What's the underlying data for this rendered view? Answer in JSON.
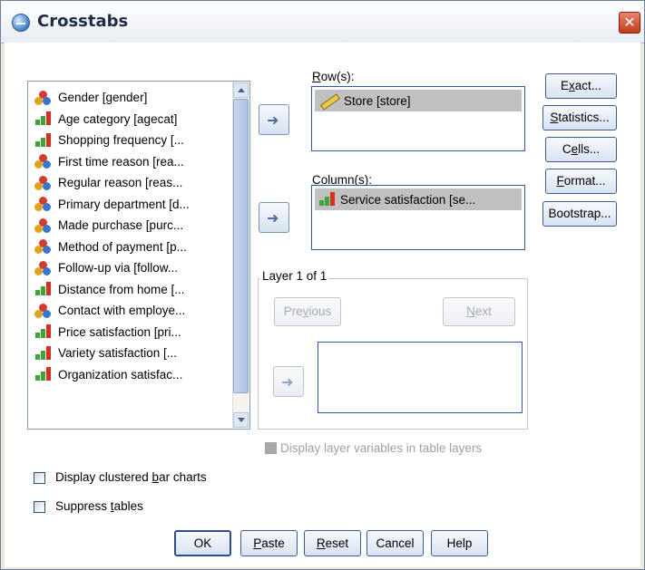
{
  "window": {
    "title": "Crosstabs",
    "close_glyph": "✕",
    "icon": "crosstabs-app-icon"
  },
  "variables": [
    {
      "label": "Gender [gender]",
      "measure": "nominal"
    },
    {
      "label": "Age category [agecat]",
      "measure": "ordinal"
    },
    {
      "label": "Shopping frequency [...",
      "measure": "ordinal"
    },
    {
      "label": "First time reason [rea...",
      "measure": "nominal"
    },
    {
      "label": "Regular reason [reas...",
      "measure": "nominal"
    },
    {
      "label": "Primary department [d...",
      "measure": "nominal"
    },
    {
      "label": "Made purchase [purc...",
      "measure": "nominal"
    },
    {
      "label": "Method of payment [p...",
      "measure": "nominal"
    },
    {
      "label": "Follow-up via [follow...",
      "measure": "nominal"
    },
    {
      "label": "Distance from home [...",
      "measure": "ordinal"
    },
    {
      "label": "Contact with employe...",
      "measure": "nominal"
    },
    {
      "label": "Price satisfaction [pri...",
      "measure": "ordinal"
    },
    {
      "label": "Variety satisfaction [...",
      "measure": "ordinal"
    },
    {
      "label": "Organization satisfac...",
      "measure": "ordinal"
    }
  ],
  "rows": {
    "label_prefix": "",
    "label_hot": "R",
    "label_rest": "ow(s):",
    "items": [
      {
        "label": "Store [store]",
        "measure": "scale"
      }
    ]
  },
  "columns": {
    "label_hot": "C",
    "label_rest": "olumn(s):",
    "items": [
      {
        "label": "Service satisfaction [se...",
        "measure": "ordinal"
      }
    ]
  },
  "layer": {
    "title": "Layer 1 of 1",
    "previous_pre": "Pre",
    "previous_hot": "v",
    "previous_post": "ious",
    "next_hot": "N",
    "next_post": "ext"
  },
  "side_buttons": {
    "exact_pre": "E",
    "exact_hot": "x",
    "exact_post": "act...",
    "statistics_hot": "S",
    "statistics_post": "tatistics...",
    "cells_pre": "C",
    "cells_hot": "e",
    "cells_post": "lls...",
    "format_hot": "F",
    "format_post": "ormat...",
    "bootstrap": "Bootstrap..."
  },
  "options": {
    "display_layer_vars": "Display layer variables in table layers",
    "clustered_pre": "Display clustered ",
    "clustered_hot": "b",
    "clustered_post": "ar charts",
    "suppress_pre": "Suppress ",
    "suppress_hot": "t",
    "suppress_post": "ables"
  },
  "footer": {
    "ok": "OK",
    "paste_hot": "P",
    "paste_post": "aste",
    "reset_hot": "R",
    "reset_post": "eset",
    "cancel": "Cancel",
    "help": "Help"
  },
  "colors": {
    "accent_border": "#3658a6",
    "selection_gray": "#c0c0c0",
    "close_red": "#c43b1a"
  }
}
